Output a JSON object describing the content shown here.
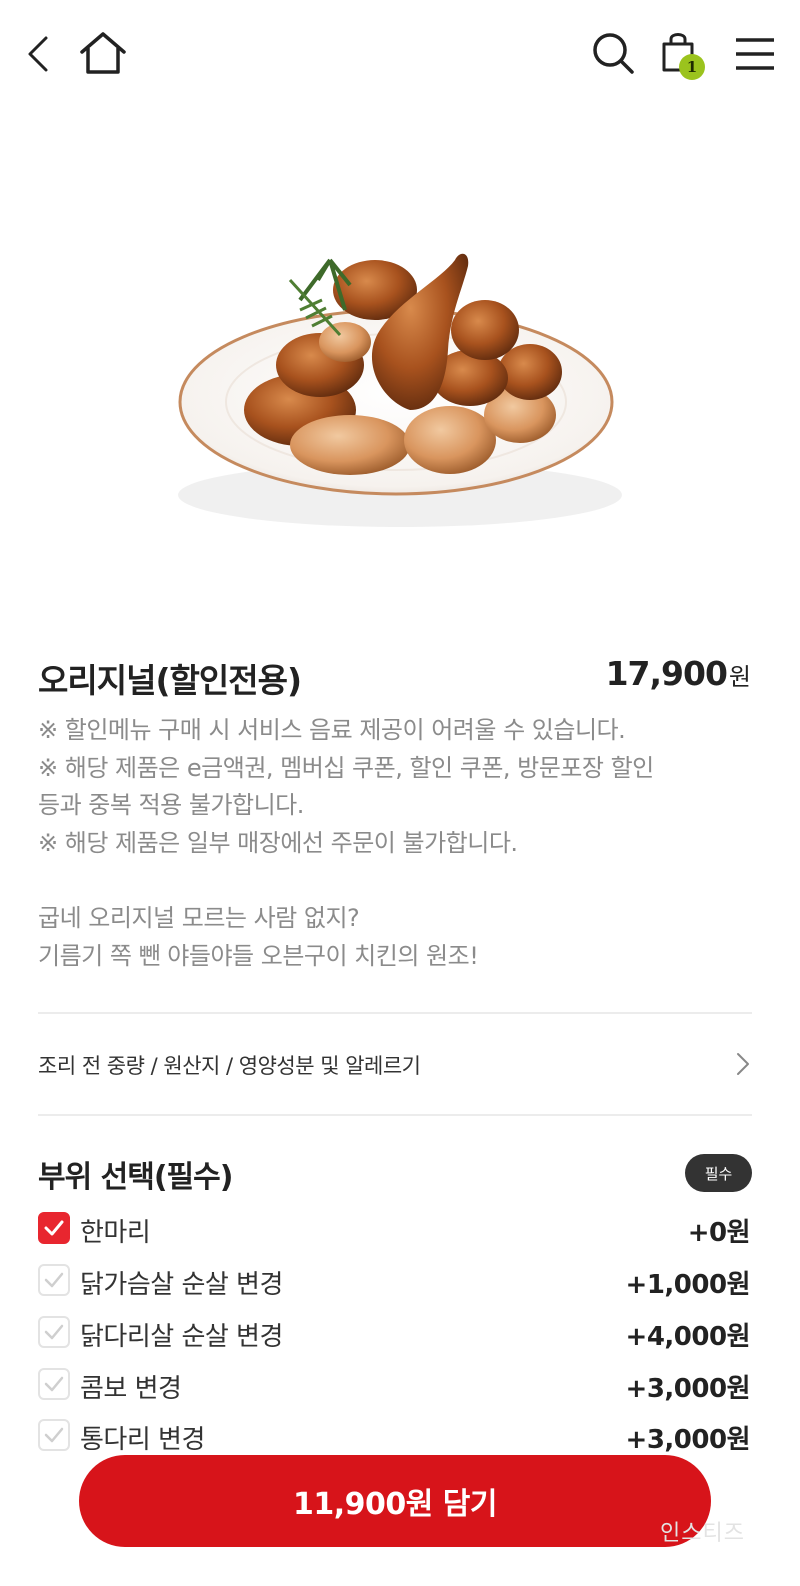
{
  "header": {
    "cart_count": "1"
  },
  "product": {
    "name": "오리지널(할인전용)",
    "price": "17,900",
    "price_unit": "원",
    "notes": [
      "※ 할인메뉴 구매 시 서비스 음료 제공이 어려울 수 있습니다.",
      "※ 해당 제품은 e금액권, 멤버십 쿠폰, 할인 쿠폰, 방문포장 할인",
      "등과 중복 적용 불가합니다.",
      "※ 해당 제품은 일부 매장에선 주문이 불가합니다."
    ],
    "description": [
      "굽네 오리지널 모르는 사람 없지?",
      "기름기 쪽 뺀 야들야들 오븐구이 치킨의 원조!"
    ]
  },
  "info_row": {
    "label": "조리 전 중량 / 원산지 / 영양성분 및 알레르기"
  },
  "part_selection": {
    "title": "부위 선택(필수)",
    "badge": "필수",
    "options": [
      {
        "label": "한마리",
        "price": "+0원",
        "checked": true
      },
      {
        "label": "닭가슴살 순살 변경",
        "price": "+1,000원",
        "checked": false
      },
      {
        "label": "닭다리살 순살 변경",
        "price": "+4,000원",
        "checked": false
      },
      {
        "label": "콤보 변경",
        "price": "+3,000원",
        "checked": false
      },
      {
        "label": "통다리 변경",
        "price": "+3,000원",
        "checked": false
      }
    ]
  },
  "cta": {
    "label": "11,900원 담기"
  },
  "watermark": "인스티즈",
  "colors": {
    "accent": "#d7141a",
    "checkbox_checked": "#e8262f",
    "cart_badge": "#9bc31d",
    "muted_text": "#8b8b8b"
  }
}
